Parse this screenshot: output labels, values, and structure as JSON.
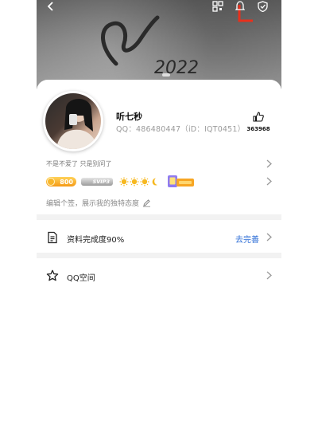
{
  "cover": {
    "scribble_text": "2022",
    "red_mark_color": "#e8301c"
  },
  "topbar": {
    "icons": [
      "back-arrow-icon",
      "qr-code-icon",
      "bell-icon",
      "shield-icon"
    ]
  },
  "profile": {
    "name": "听七秒",
    "qq_line": "QQ：486480447（iD：IQT0451）",
    "like_count": "363968"
  },
  "sign_row": {
    "text": "不是不爱了 只是别问了"
  },
  "badges": {
    "level": "800",
    "vip": "SVIP3"
  },
  "signature": {
    "text": "编辑个签，展示我的独特态度"
  },
  "profile_completion": {
    "label": "资料完成度90%",
    "action": "去完善",
    "accent": "#2b6cd6"
  },
  "qzone": {
    "label": "QQ空间"
  }
}
